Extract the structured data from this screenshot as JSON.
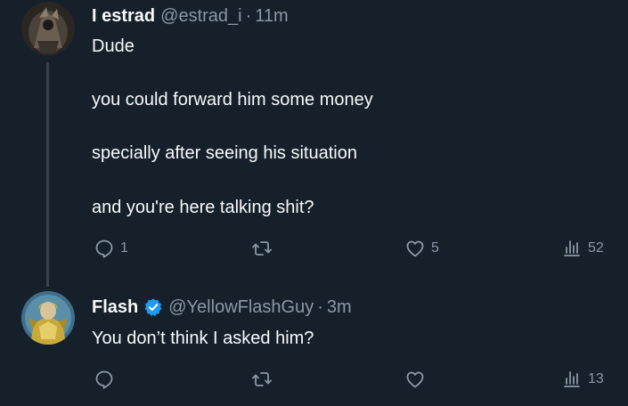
{
  "tweets": [
    {
      "display_name": "I estrad",
      "handle": "@estrad_i",
      "separator": "·",
      "time": "11m",
      "verified": false,
      "lines": [
        "Dude",
        "you could forward him some money",
        "specially after seeing his situation",
        "and you're here talking shit?"
      ],
      "replies": "1",
      "retweets": "",
      "likes": "5",
      "views": "52"
    },
    {
      "display_name": "Flash",
      "handle": "@YellowFlashGuy",
      "separator": "·",
      "time": "3m",
      "verified": true,
      "lines": [
        "You don’t think I asked him?"
      ],
      "replies": "",
      "retweets": "",
      "likes": "",
      "views": "13"
    }
  ],
  "colors": {
    "background": "#15202b",
    "text": "#f7f9f9",
    "secondary": "#8b98a5",
    "thread_line": "#38444d",
    "verified": "#1d9bf0"
  },
  "icons": [
    "reply-icon",
    "retweet-icon",
    "like-icon",
    "views-icon",
    "verified-badge-icon"
  ]
}
